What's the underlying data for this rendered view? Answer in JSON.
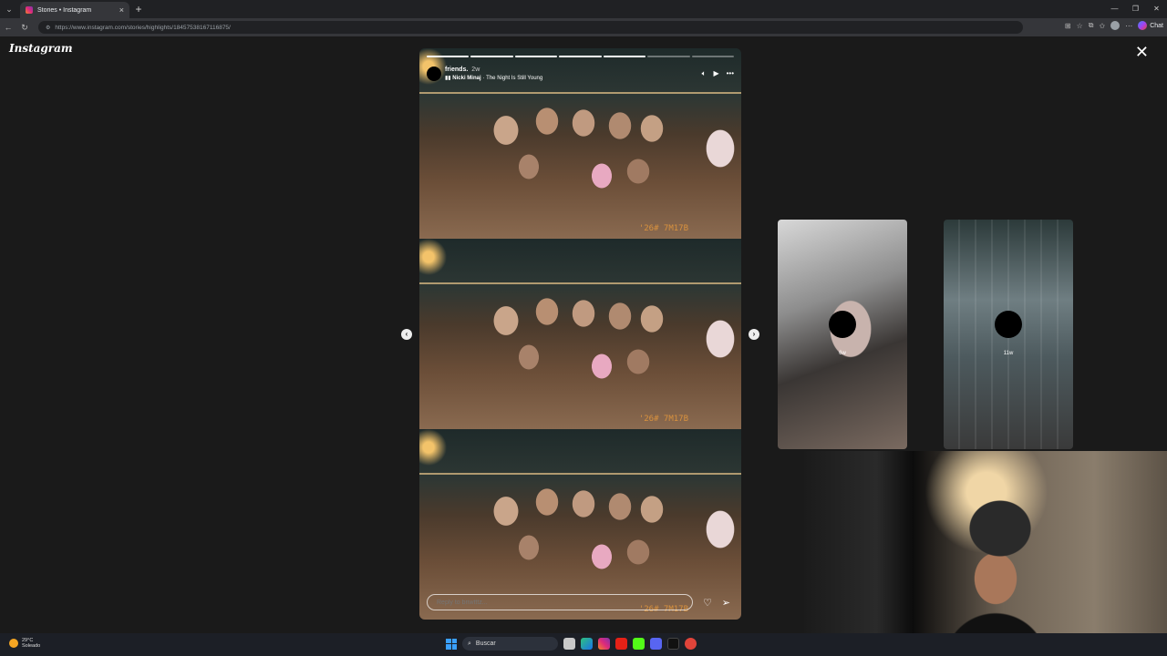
{
  "browser": {
    "tab_title": "Stories • Instagram",
    "tab_close": "×",
    "new_tab": "+",
    "url": "https://www.instagram.com/stories/highlights/18457538167116875/",
    "chat_label": "Chat"
  },
  "page": {
    "logo": "Instagram",
    "close_glyph": "✕"
  },
  "story": {
    "username": "friends.",
    "age": "2w",
    "music_artist": "Nicki Minaj",
    "music_title": "· The Night Is Still Young",
    "progress_total": 7,
    "progress_done": 5,
    "photo_stamp": "'26# 7M17B",
    "reply_placeholder": "Reply to briwtttz...",
    "prev_glyph": "‹",
    "next_glyph": "›"
  },
  "thumbnails": [
    {
      "age": "6w"
    },
    {
      "age": "11w"
    }
  ],
  "taskbar": {
    "temperature": "29°C",
    "weather_status": "Soleado",
    "search_label": "Buscar"
  },
  "colors": {
    "background": "#1a1a1a",
    "browser_chrome": "#202124",
    "taskbar": "#1c1f26"
  }
}
